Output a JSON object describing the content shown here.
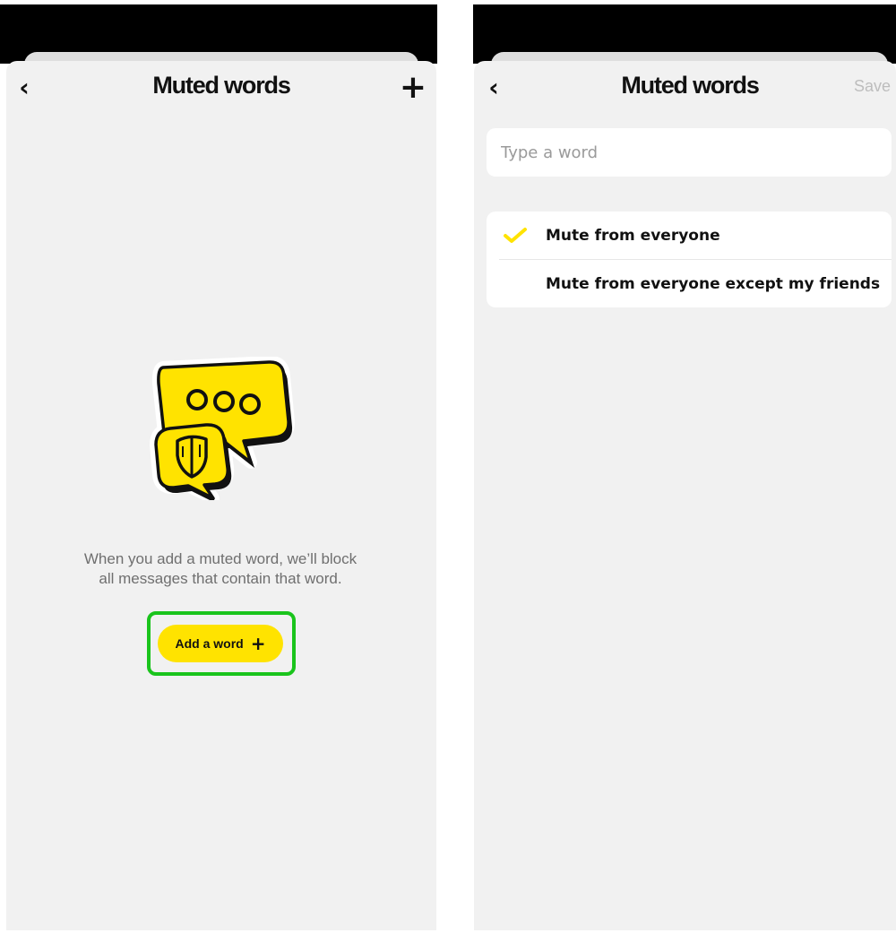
{
  "left_screen": {
    "header": {
      "back_icon": "chevron-left-icon",
      "back_glyph": "‹",
      "title": "Muted words",
      "add_icon": "plus-icon",
      "add_glyph": "+"
    },
    "empty_state": {
      "illustration_icon": "chat-bubble-shield-icon",
      "message_line_1": "When you add a muted word, we’ll block",
      "message_line_2": "all messages that contain that word.",
      "add_button_label": "Add a word",
      "add_button_glyph": "+"
    }
  },
  "right_screen": {
    "header": {
      "back_icon": "chevron-left-icon",
      "back_glyph": "‹",
      "title": "Muted words",
      "save_label": "Save"
    },
    "word_input": {
      "placeholder": "Type a word",
      "value": ""
    },
    "mute_options": [
      {
        "label": "Mute from everyone",
        "selected": true
      },
      {
        "label": "Mute from everyone except my friends",
        "selected": false
      }
    ]
  },
  "colors": {
    "accent_yellow": "#ffe300",
    "highlight_green": "#1ac41c",
    "sheet_background": "#f1f1f1",
    "top_bar": "#000000",
    "muted_text": "#6f6f6f",
    "disabled_save": "#bdbdbd"
  }
}
